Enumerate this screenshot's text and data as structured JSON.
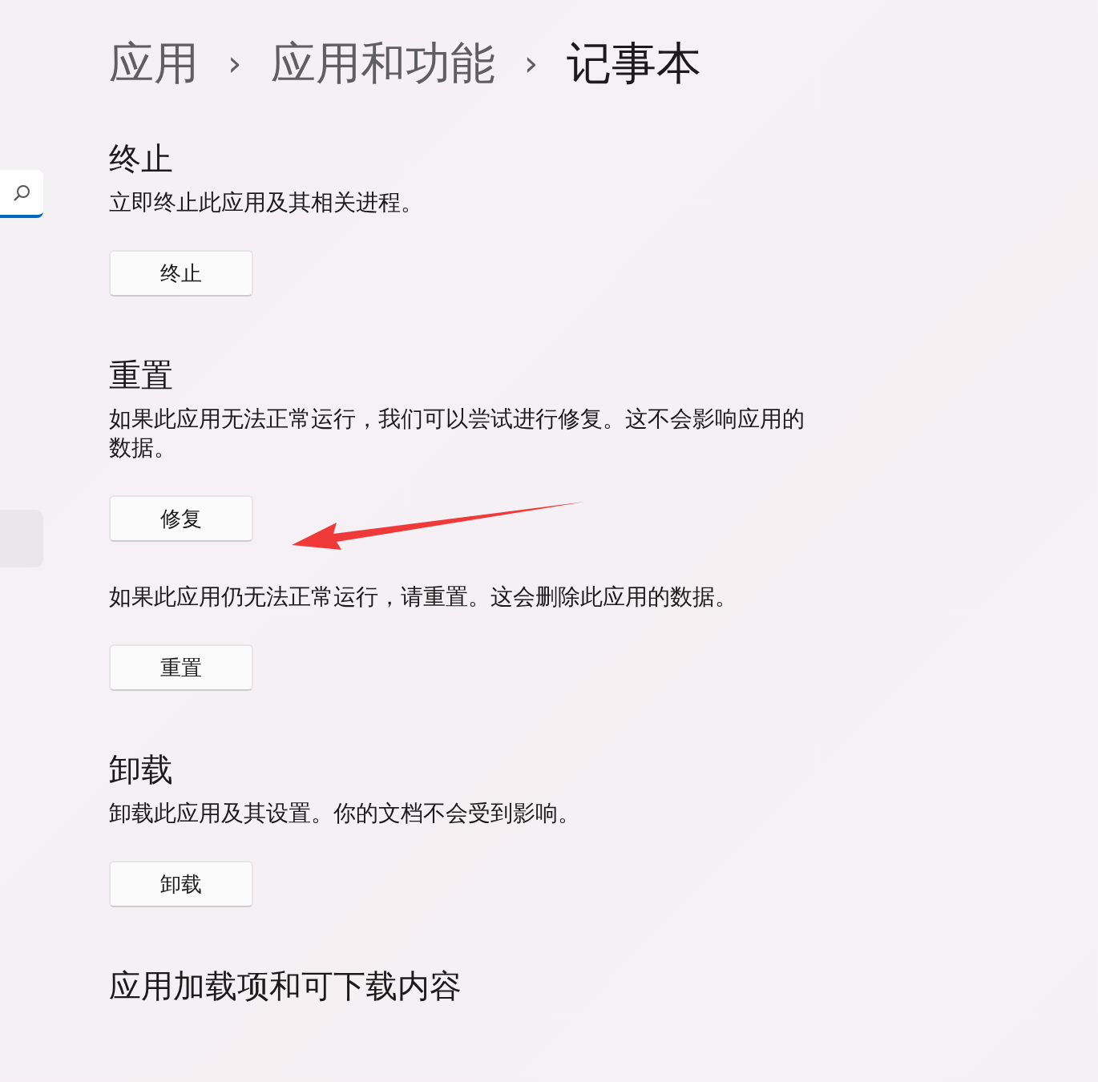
{
  "breadcrumb": [
    {
      "label": "应用",
      "current": false
    },
    {
      "label": "应用和功能",
      "current": false
    },
    {
      "label": "记事本",
      "current": true
    }
  ],
  "breadcrumb_separator": "›",
  "sections": [
    {
      "title": "终止",
      "blocks": [
        {
          "text": "立即终止此应用及其相关进程。",
          "button": "终止"
        }
      ]
    },
    {
      "title": "重置",
      "blocks": [
        {
          "text": "如果此应用无法正常运行，我们可以尝试进行修复。这不会影响应用的数据。",
          "button": "修复"
        },
        {
          "text": "如果此应用仍无法正常运行，请重置。这会删除此应用的数据。",
          "button": "重置"
        }
      ]
    },
    {
      "title": "卸载",
      "blocks": [
        {
          "text": "卸载此应用及其设置。你的文档不会受到影响。",
          "button": "卸载"
        }
      ]
    },
    {
      "title": "应用加载项和可下载内容"
    }
  ]
}
